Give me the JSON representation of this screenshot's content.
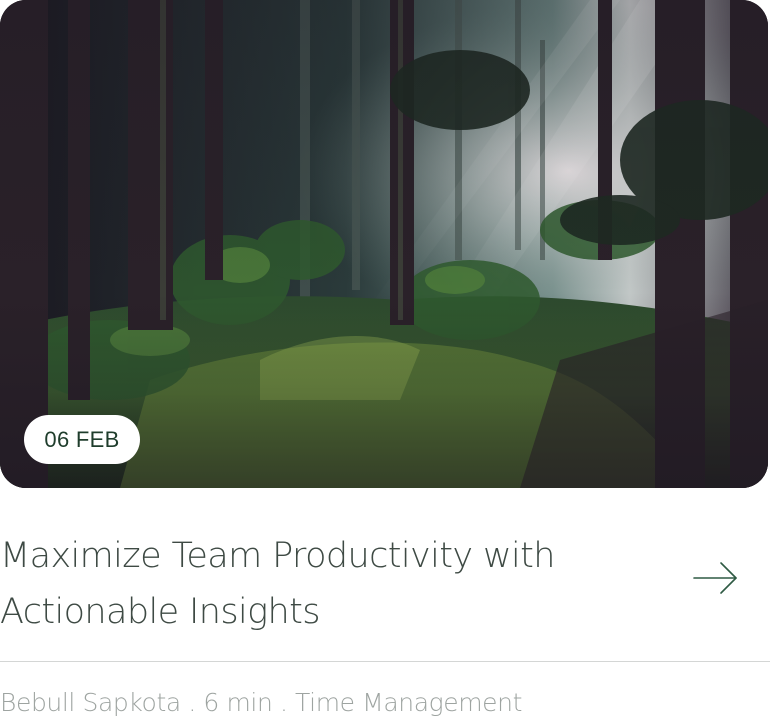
{
  "post": {
    "date": "06 FEB",
    "title_line1": "Maximize Team Productivity with",
    "title_line2": "Actionable Insights",
    "author": "Bebull Sapkota",
    "separator": ".",
    "read_time": "6 min",
    "category": "Time Management"
  },
  "image": {
    "alt": "Sunlit misty forest"
  },
  "icons": {
    "read_more": "arrow-right-icon"
  },
  "colors": {
    "title": "#3e4a44",
    "meta": "#9ea4a1",
    "badge_text": "#1f3d2c",
    "arrow": "#2f5a44",
    "divider": "#d4d6d5"
  }
}
